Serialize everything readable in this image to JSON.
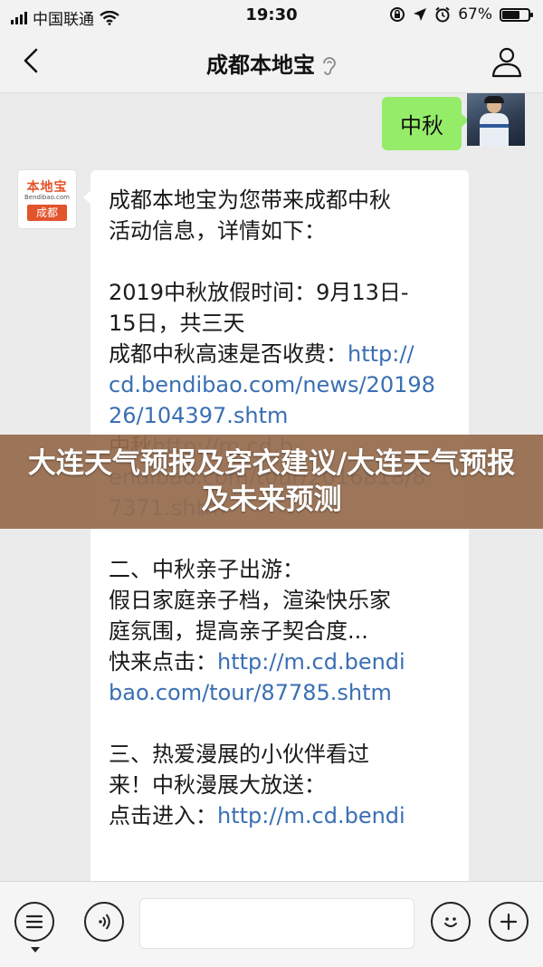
{
  "status_bar": {
    "carrier": "中国联通",
    "time": "19:30",
    "battery_percent": "67%",
    "battery_level": 0.67
  },
  "header": {
    "title": "成都本地宝",
    "back_icon": "chevron-left-icon",
    "profile_icon": "person-icon",
    "voice_icon": "ear-icon"
  },
  "messages": {
    "outgoing": {
      "text": "中秋"
    },
    "incoming": {
      "avatar": {
        "brand": "本地宝",
        "brand_sub": "Bendibao.com",
        "city": "成都"
      },
      "paragraphs": [
        [
          {
            "text": "成都本地宝为您带来成都中秋"
          },
          {
            "text": "活动信息，详情如下："
          }
        ],
        [
          {
            "text": "2019中秋放假时间：9月13日-"
          },
          {
            "text": "15日，共三天"
          },
          {
            "text": "成都中秋高速是否收费：",
            "link": "http://"
          },
          {
            "link": "cd.bendibao.com/news/20198"
          },
          {
            "link": "26/104397.shtm"
          },
          {
            "text": "中秋",
            "link": "http://m.cd.b"
          },
          {
            "link": "endibao.com/tour/2016818/8"
          },
          {
            "link": "7371.shtm"
          }
        ],
        [
          {
            "text": "二、中秋亲子出游："
          },
          {
            "text": "假日家庭亲子档，渲染快乐家"
          },
          {
            "text": "庭氛围，提高亲子契合度..."
          },
          {
            "text": "快来点击：",
            "link": "http://m.cd.bendi"
          },
          {
            "link": "bao.com/tour/87785.shtm"
          }
        ],
        [
          {
            "text": "三、热爱漫展的小伙伴看过"
          },
          {
            "text": "来！中秋漫展大放送："
          },
          {
            "text": "点击进入：",
            "link": "http://m.cd.bendi"
          }
        ]
      ]
    }
  },
  "overlay_banner": {
    "text": "大连天气预报及穿衣建议/大连天气预报及未来预测"
  },
  "input_bar": {
    "menu_icon": "menu-list-icon",
    "voice_icon": "voice-icon",
    "emoji_icon": "emoji-icon",
    "plus_icon": "plus-icon"
  },
  "colors": {
    "link": "#3a6fb4",
    "outgoing_bubble": "#95ec69",
    "banner": "#966c4e"
  }
}
